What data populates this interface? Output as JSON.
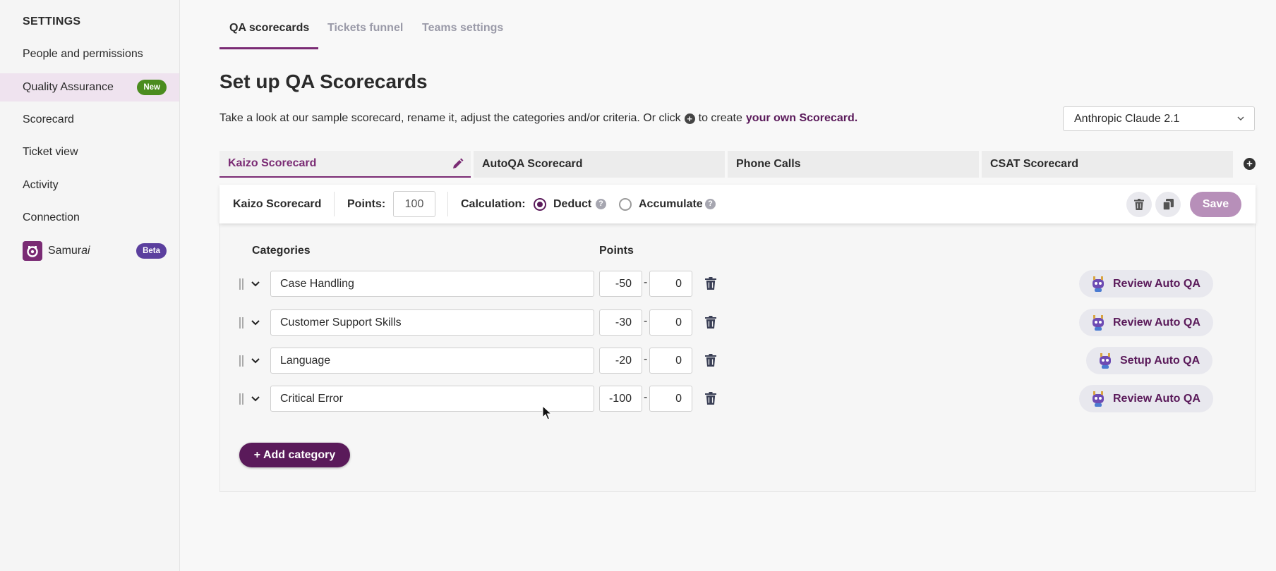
{
  "sidebar": {
    "title": "SETTINGS",
    "items": [
      {
        "label": "People and permissions"
      },
      {
        "label": "Quality Assurance",
        "badge": "New"
      },
      {
        "label": "Scorecard"
      },
      {
        "label": "Ticket view"
      },
      {
        "label": "Activity"
      },
      {
        "label": "Connection"
      }
    ],
    "samurai": {
      "label_prefix": "Samur",
      "label_italic": "ai",
      "badge": "Beta"
    }
  },
  "tabs": [
    "QA scorecards",
    "Tickets funnel",
    "Teams settings"
  ],
  "page": {
    "title": "Set up QA Scorecards",
    "description_before": "Take a look at our sample scorecard, rename it, adjust the categories and/or criteria. Or click",
    "description_middle": "to create",
    "description_link": "your own Scorecard.",
    "plus_symbol": "+"
  },
  "model_select": {
    "value": "Anthropic Claude 2.1"
  },
  "scorecards": [
    "Kaizo Scorecard",
    "AutoQA Scorecard",
    "Phone Calls",
    "CSAT Scorecard"
  ],
  "toolbar": {
    "name": "Kaizo Scorecard",
    "points_label": "Points:",
    "points_value": "100",
    "calculation_label": "Calculation:",
    "deduct_label": "Deduct",
    "accumulate_label": "Accumulate",
    "help_symbol": "?",
    "selected": "Deduct",
    "save_label": "Save"
  },
  "table": {
    "headers": {
      "categories": "Categories",
      "points": "Points"
    },
    "rows": [
      {
        "name": "Case Handling",
        "min": "-50",
        "max": "0",
        "action": "Review Auto QA"
      },
      {
        "name": "Customer Support Skills",
        "min": "-30",
        "max": "0",
        "action": "Review Auto QA"
      },
      {
        "name": "Language",
        "min": "-20",
        "max": "0",
        "action": "Setup Auto QA"
      },
      {
        "name": "Critical Error",
        "min": "-100",
        "max": "0",
        "action": "Review Auto QA"
      }
    ],
    "dash": "-"
  },
  "add_category_label": "+ Add category",
  "colors": {
    "accent": "#7a2b74",
    "dark_accent": "#5a1a5a",
    "new_badge": "#4b8c1f",
    "beta_badge": "#5b3f9e",
    "save_disabled": "#b78fb9"
  }
}
